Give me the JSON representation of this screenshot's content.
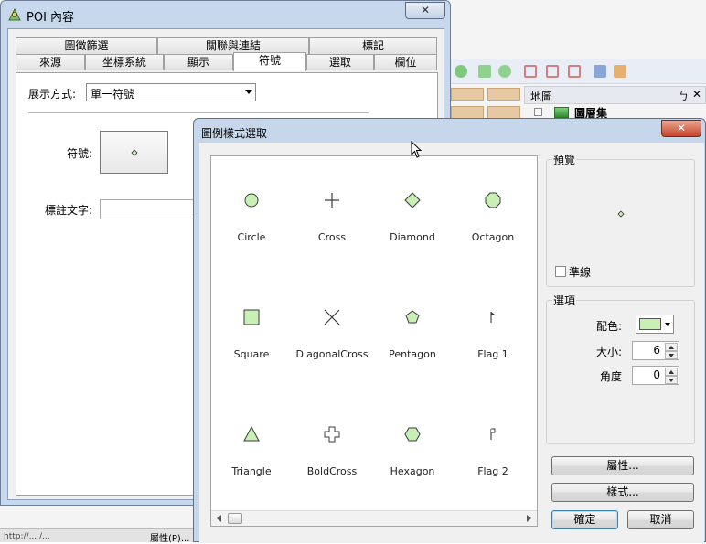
{
  "colors": {
    "symbol_fill": "#c8f0b4",
    "symbol_stroke": "#3a3a3a",
    "title_bar": "#c6d7ec"
  },
  "background": {
    "map_panel_title": "地圖",
    "pin": "ㄅ",
    "close": "✕",
    "layer_set": "圖層集",
    "expander": "−",
    "status_label": "屬性(P)...",
    "status_url": "http://... /..."
  },
  "poi_window": {
    "title": "POI 內容",
    "close": "✕",
    "tabs_top": [
      "圖徵篩選",
      "關聯與連結",
      "標記"
    ],
    "tabs_bottom": [
      "來源",
      "坐標系統",
      "顯示",
      "符號",
      "選取",
      "欄位"
    ],
    "active_tab": "符號",
    "display_mode_label": "展示方式:",
    "display_mode_value": "單一符號",
    "symbol_label": "符號:",
    "label_text_label": "標註文字:"
  },
  "legend_dialog": {
    "title": "圖例樣式選取",
    "close": "✕",
    "symbols": [
      {
        "name": "Circle",
        "icon": "circle-icon"
      },
      {
        "name": "Cross",
        "icon": "cross-icon"
      },
      {
        "name": "Diamond",
        "icon": "diamond-icon"
      },
      {
        "name": "Octagon",
        "icon": "octagon-icon"
      },
      {
        "name": "Square",
        "icon": "square-icon"
      },
      {
        "name": "DiagonalCross",
        "icon": "diagonal-cross-icon"
      },
      {
        "name": "Pentagon",
        "icon": "pentagon-icon"
      },
      {
        "name": "Flag 1",
        "icon": "flag-1-icon"
      },
      {
        "name": "Triangle",
        "icon": "triangle-icon"
      },
      {
        "name": "BoldCross",
        "icon": "bold-cross-icon"
      },
      {
        "name": "Hexagon",
        "icon": "hexagon-icon"
      },
      {
        "name": "Flag 2",
        "icon": "flag-2-icon"
      }
    ],
    "preview_label": "預覽",
    "crosshair_label": "準線",
    "options_label": "選項",
    "color_label": "配色:",
    "color_value": "#c8f0b4",
    "size_label": "大小:",
    "size_value": "6",
    "angle_label": "角度",
    "angle_value": "0",
    "properties_button": "屬性...",
    "style_button": "樣式...",
    "ok_button": "確定",
    "cancel_button": "取消"
  }
}
